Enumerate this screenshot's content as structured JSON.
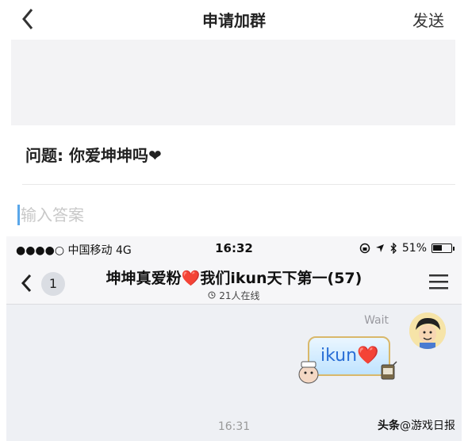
{
  "nav": {
    "title": "申请加群",
    "send_label": "发送"
  },
  "form": {
    "question": "问题: 你爱坤坤吗❤",
    "answer_placeholder": "输入答案"
  },
  "chat": {
    "status_bar": {
      "carrier": "●●●●○ 中国移动  4G",
      "time": "16:32",
      "right_text": "51%",
      "battery_level": 0.51
    },
    "unread_count": "1",
    "group_name_a": "坤坤真爱粉",
    "group_heart": "❤️",
    "group_name_b": "我们ikun天下第一(57)",
    "online_text": "21人在线",
    "message_status": "Wait",
    "message_text": "ikun❤️",
    "timestamp": "16:31"
  },
  "watermark": {
    "prefix": "头条",
    "text": "@游戏日报"
  },
  "colors": {
    "accent_blue": "#5aa7ea",
    "heart_red": "#e53935",
    "bubble_blue": "#bfe3ff"
  }
}
